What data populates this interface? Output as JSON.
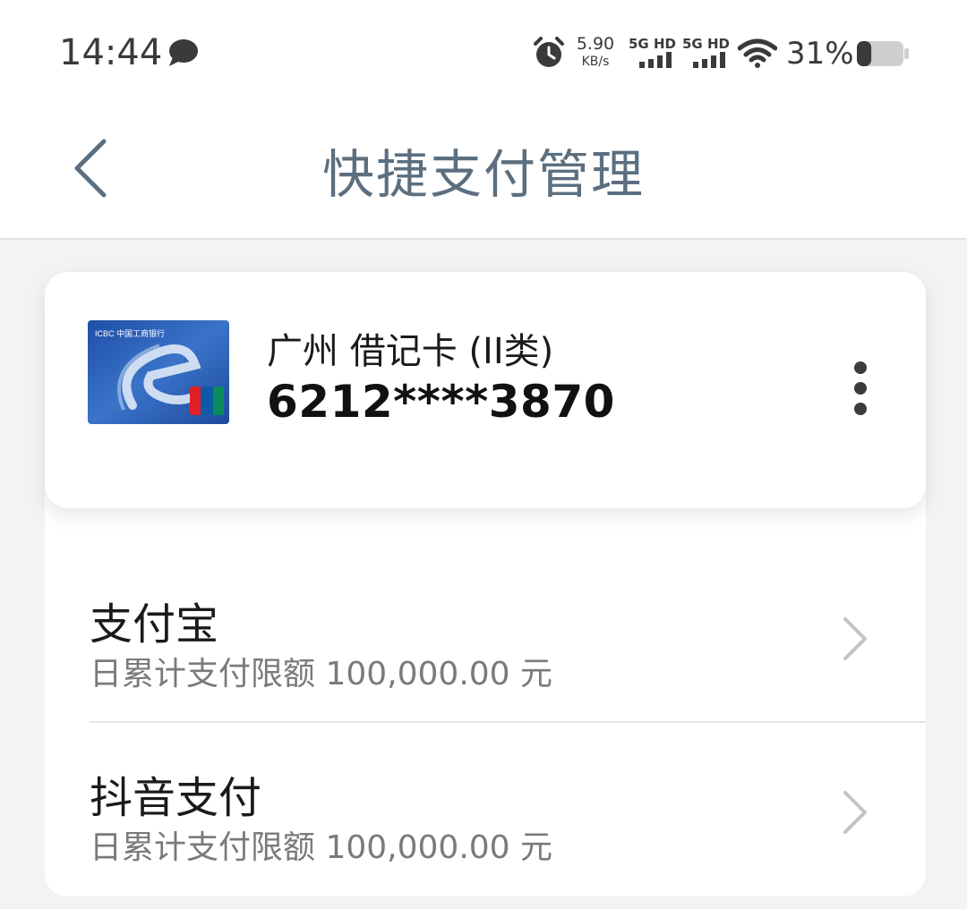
{
  "status_bar": {
    "time": "14:44",
    "net_speed_value": "5.90",
    "net_speed_unit": "KB/s",
    "sim1_label": "5G HD",
    "sim2_label": "5G HD",
    "battery_percent": "31%",
    "battery_level": 0.31
  },
  "header": {
    "title": "快捷支付管理"
  },
  "card": {
    "name": "广州 借记卡 (II类)",
    "number": "6212****3870",
    "image_bank_text": "ICBC  中国工商银行"
  },
  "payments": [
    {
      "name": "支付宝",
      "limit": "日累计支付限额 100,000.00 元"
    },
    {
      "name": "抖音支付",
      "limit": "日累计支付限额 100,000.00 元"
    }
  ],
  "colors": {
    "title": "#5b6f80",
    "background": "#f2f3f5",
    "card_blue": "#2f64b8"
  }
}
